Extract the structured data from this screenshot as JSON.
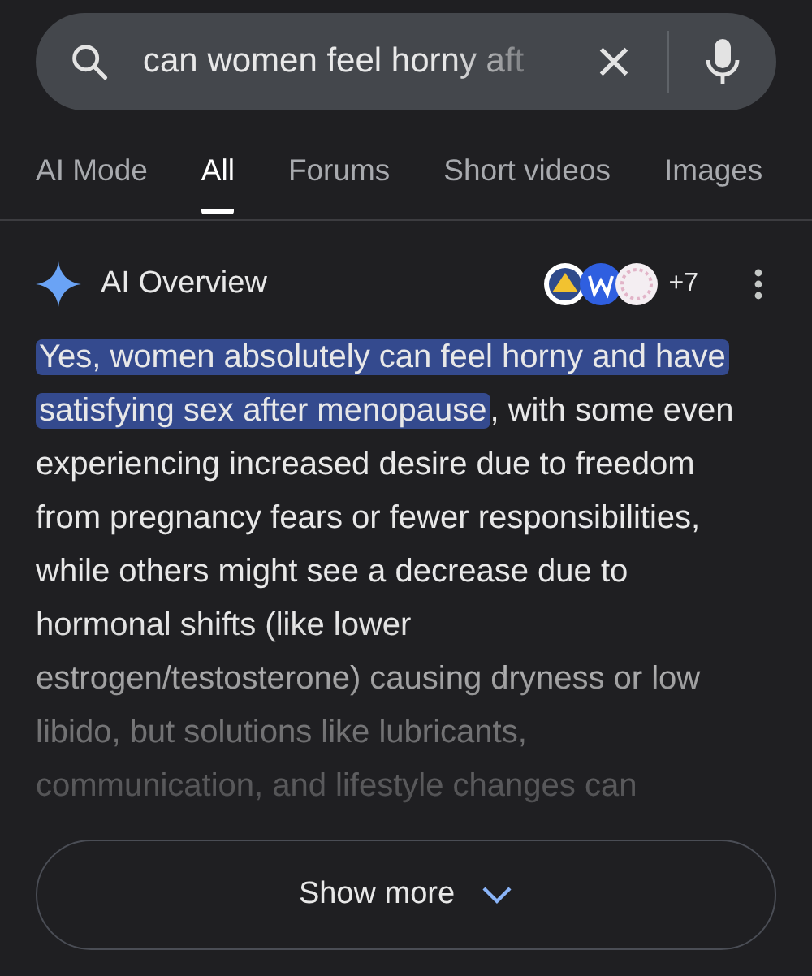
{
  "search": {
    "query": "can women feel horny aft"
  },
  "tabs": [
    {
      "label": "AI Mode",
      "selected": false
    },
    {
      "label": "All",
      "selected": true
    },
    {
      "label": "Forums",
      "selected": false
    },
    {
      "label": "Short videos",
      "selected": false
    },
    {
      "label": "Images",
      "selected": false
    }
  ],
  "ai_overview": {
    "title": "AI Overview",
    "sources_more": "+7",
    "highlight": "Yes, women absolutely can feel horny and have satisfying sex after menopause",
    "text": ", with some even experiencing increased desire due to freedom from pregnancy fears or fewer responsibilities, while others might see a decrease due to hormonal shifts (like lower estrogen/testosterone) causing dryness or low libido, but solutions like lubricants, communication, and lifestyle changes can",
    "button": "Show more"
  }
}
